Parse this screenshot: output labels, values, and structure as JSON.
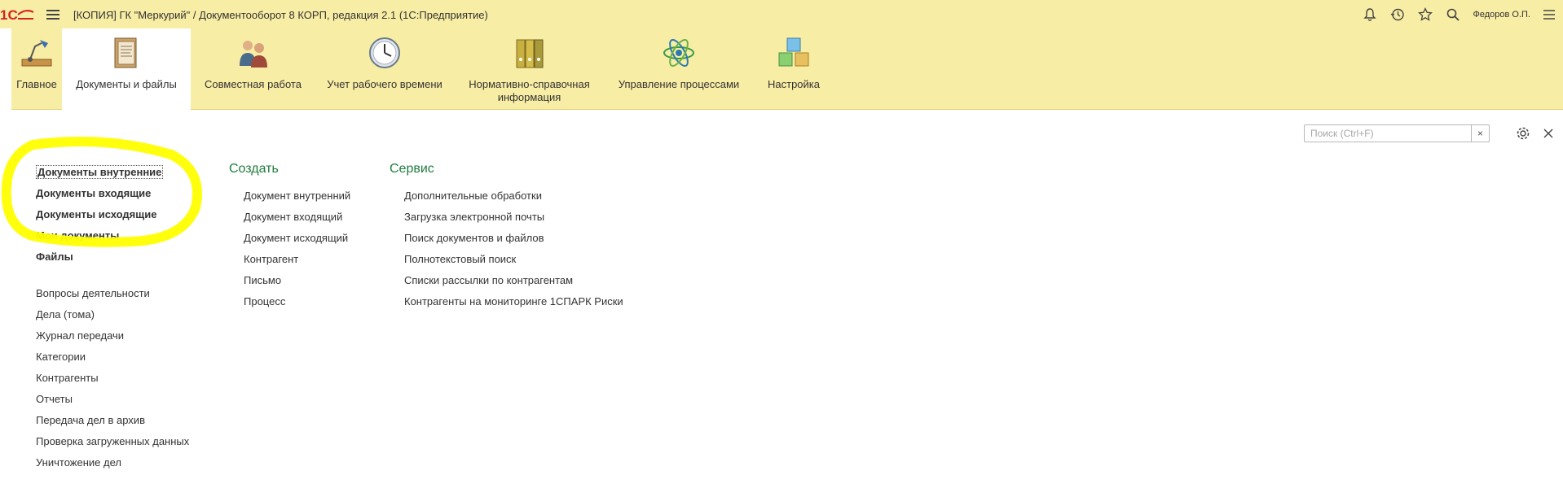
{
  "titlebar": {
    "title": "[КОПИЯ] ГК \"Меркурий\" / Документооборот 8 КОРП, редакция 2.1  (1С:Предприятие)",
    "user": "Федоров О.П."
  },
  "sections": [
    {
      "label": "Главное",
      "icon": "desk-lamp-icon"
    },
    {
      "label": "Документы и файлы",
      "icon": "documents-book-icon"
    },
    {
      "label": "Совместная работа",
      "icon": "people-icon"
    },
    {
      "label": "Учет рабочего времени",
      "icon": "clock-icon"
    },
    {
      "label": "Нормативно-справочная информация",
      "icon": "binders-icon"
    },
    {
      "label": "Управление процессами",
      "icon": "process-atom-icon"
    },
    {
      "label": "Настройка",
      "icon": "cubes-icon"
    }
  ],
  "active_section": "Документы и файлы",
  "search": {
    "placeholder": "Поиск (Ctrl+F)",
    "clear": "×"
  },
  "nav": {
    "bold": [
      "Документы внутренние",
      "Документы входящие",
      "Документы исходящие",
      "Мои документы",
      "Файлы"
    ],
    "regular": [
      "Вопросы деятельности",
      "Дела (тома)",
      "Журнал передачи",
      "Категории",
      "Контрагенты",
      "Отчеты",
      "Передача дел в архив",
      "Проверка загруженных данных",
      "Уничтожение дел"
    ]
  },
  "create": {
    "title": "Создать",
    "items": [
      "Документ внутренний",
      "Документ входящий",
      "Документ исходящий",
      "Контрагент",
      "Письмо",
      "Процесс"
    ]
  },
  "service": {
    "title": "Сервис",
    "items": [
      "Дополнительные обработки",
      "Загрузка электронной почты",
      "Поиск документов и файлов",
      "Полнотекстовый поиск",
      "Списки рассылки по контрагентам",
      "Контрагенты на мониторинге 1СПАРК Риски"
    ]
  },
  "colors": {
    "panel": "#f8eda4",
    "group_title": "#1f7c3f",
    "highlight": "#ffff00"
  }
}
